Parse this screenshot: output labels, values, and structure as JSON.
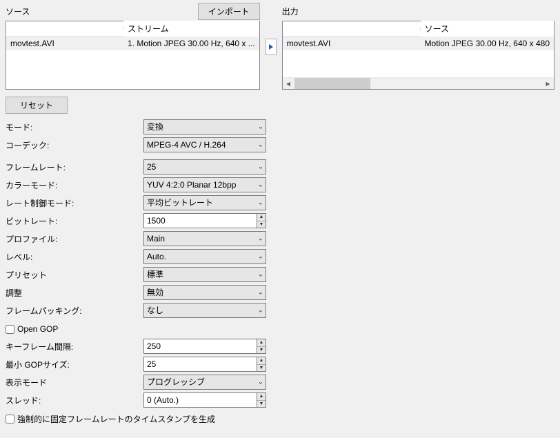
{
  "source": {
    "title": "ソース",
    "import_label": "インポート",
    "columns": {
      "c1": "",
      "c2": "ストリーム"
    },
    "row": {
      "file": "movtest.AVI",
      "stream": "1. Motion JPEG 30.00 Hz, 640 x ..."
    }
  },
  "arrow": "▶",
  "output": {
    "title": "出力",
    "columns": {
      "c1": "",
      "c2": "ソース"
    },
    "row": {
      "file": "movtest.AVI",
      "source": "Motion JPEG 30.00 Hz, 640 x 480"
    }
  },
  "reset_label": "リセット",
  "fields": {
    "mode": {
      "label": "モード:",
      "value": "変換"
    },
    "codec": {
      "label": "コーデック:",
      "value": "MPEG-4 AVC / H.264"
    },
    "framerate": {
      "label": "フレームレート:",
      "value": "25"
    },
    "colormode": {
      "label": "カラーモード:",
      "value": "YUV 4:2:0 Planar 12bpp"
    },
    "ratecontrol": {
      "label": "レート制御モード:",
      "value": "平均ビットレート"
    },
    "bitrate": {
      "label": "ビットレート:",
      "value": "1500"
    },
    "profile": {
      "label": "プロファイル:",
      "value": "Main"
    },
    "level": {
      "label": "レベル:",
      "value": "Auto."
    },
    "preset": {
      "label": "プリセット",
      "value": "標準"
    },
    "tuning": {
      "label": "調整",
      "value": "無効"
    },
    "framepacking": {
      "label": "フレームパッキング:",
      "value": "なし"
    },
    "opengop": {
      "label": "Open GOP"
    },
    "keyframeinterval": {
      "label": "キーフレーム間隔:",
      "value": "250"
    },
    "mingopsize": {
      "label": "最小 GOPサイズ:",
      "value": "25"
    },
    "displaymode": {
      "label": "表示モード",
      "value": "プログレッシブ"
    },
    "threads": {
      "label": "スレッド:",
      "value": "0 (Auto.)"
    },
    "forcefixed": {
      "label": "強制的に固定フレームレートのタイムスタンプを生成"
    }
  }
}
